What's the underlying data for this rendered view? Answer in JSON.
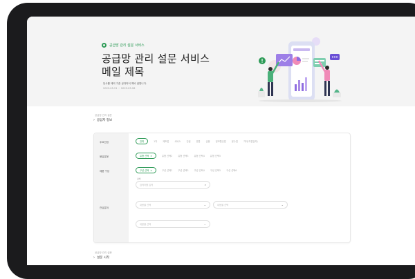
{
  "hero": {
    "brand": "공급망 관리 설문 서비스",
    "title": "공급망 관리 설문 서비스 메일 제목",
    "description": "당사를 제외 기준 공개되어 예비 설명니다.",
    "period": "2023.05.21 ~ 2023.05.28"
  },
  "sections": [
    {
      "label": "공급망 관리 설문",
      "title": "응답자 정보"
    },
    {
      "label": "공급망 관리 설문",
      "title": "설문 시작"
    }
  ],
  "form": {
    "rows": [
      {
        "label": "주요산업",
        "chips": [
          "전체",
          "1차",
          "제조업",
          "서비스",
          "건설",
          "유통",
          "금융",
          "정보통신업",
          "운수업",
          "기타(직접입력)"
        ]
      },
      {
        "label": "응답유형",
        "chips": [
          "유형 선택",
          "유형 선택2",
          "유형 선택3",
          "유형 선택4",
          "유형 선택5"
        ]
      },
      {
        "label": "제품 구성",
        "chips": [
          "구성 선택",
          "구성 선택2",
          "구성 선택3",
          "구성 선택4",
          "구성 선택5",
          "구성 선택6"
        ]
      },
      {
        "label": "관심분야"
      }
    ],
    "search_label": "검색",
    "search_placeholder": "검색어를 입력",
    "selects": [
      "내용을 선택",
      "내용을 선택",
      "내용을 선택"
    ]
  },
  "colors": {
    "accent": "#2e9b57",
    "bezel": "#1b1b1d"
  }
}
